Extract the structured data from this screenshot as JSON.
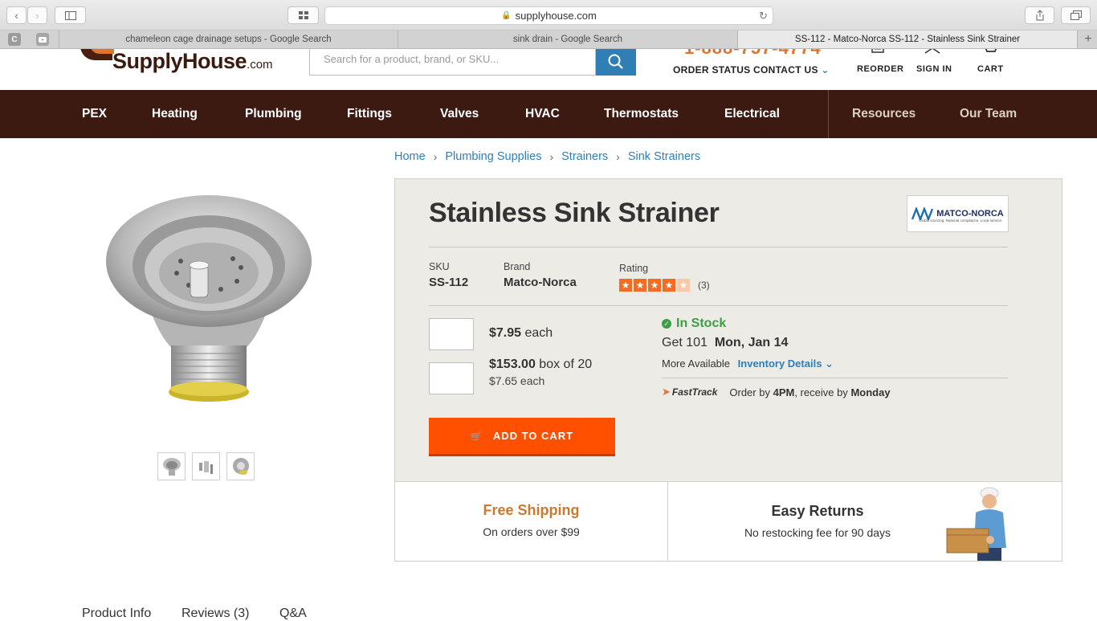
{
  "browser": {
    "url": "supplyhouse.com",
    "tabs": [
      {
        "title": "chameleon cage drainage setups - Google Search"
      },
      {
        "title": "sink drain - Google Search"
      },
      {
        "title": "SS-112 - Matco-Norca SS-112 - Stainless Sink Strainer"
      }
    ],
    "pinned": [
      "C"
    ]
  },
  "header": {
    "logo_main": "SupplyHouse",
    "logo_suffix": ".com",
    "search_placeholder": "Search for a product, brand, or SKU...",
    "phone": "1-888-757-4774",
    "order_status": "ORDER STATUS",
    "contact_us": "CONTACT US",
    "reorder": "REORDER",
    "sign_in": "SIGN IN",
    "cart": "CART"
  },
  "nav": {
    "items": [
      "PEX",
      "Heating",
      "Plumbing",
      "Fittings",
      "Valves",
      "HVAC",
      "Thermostats",
      "Electrical"
    ],
    "secondary": [
      "Resources",
      "Our Team"
    ]
  },
  "breadcrumb": [
    "Home",
    "Plumbing Supplies",
    "Strainers",
    "Sink Strainers"
  ],
  "product": {
    "title": "Stainless Sink Strainer",
    "brand_logo": "MATCO-NORCA",
    "brand_logo_tagline": "Global sourcing. National compliance. Local service.",
    "sku_label": "SKU",
    "sku": "SS-112",
    "brand_label": "Brand",
    "brand": "Matco-Norca",
    "rating_label": "Rating",
    "rating": 4,
    "rating_max": 5,
    "rating_count": "(3)",
    "price_each": "$7.95",
    "price_each_unit": "each",
    "price_box": "$153.00",
    "price_box_unit": "box of 20",
    "price_box_each": "$7.65 each",
    "stock_status": "In Stock",
    "get_prefix": "Get 101",
    "get_date": "Mon, Jan 14",
    "more_available": "More Available",
    "inventory_details": "Inventory Details",
    "fasttrack_logo": "FastTrack",
    "fasttrack_prefix": "Order by",
    "fasttrack_time": "4PM",
    "fasttrack_mid": ", receive by",
    "fasttrack_day": "Monday",
    "add_to_cart": "ADD TO CART"
  },
  "shipping": {
    "free_title": "Free Shipping",
    "free_sub": "On orders over $99",
    "returns_title": "Easy Returns",
    "returns_sub": "No restocking fee for 90 days"
  },
  "product_tabs": [
    "Product Info",
    "Reviews (3)",
    "Q&A"
  ],
  "colors": {
    "nav_bg": "#3c1a11",
    "accent_orange": "#ff5000",
    "link_blue": "#2f7fb5",
    "stock_green": "#3aa041",
    "free_shipping": "#c97a2f"
  }
}
